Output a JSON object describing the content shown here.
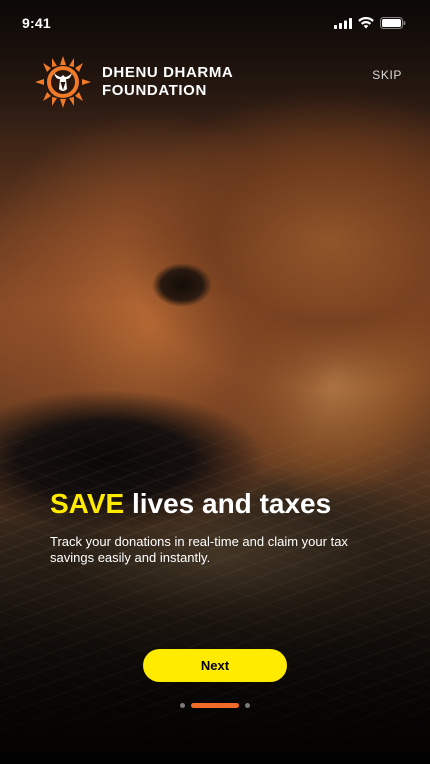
{
  "status_bar": {
    "time": "9:41",
    "icons": [
      "cellular-signal-icon",
      "wifi-icon",
      "battery-icon"
    ]
  },
  "header": {
    "brand_line1": "DHENU DHARMA",
    "brand_line2": "FOUNDATION",
    "logo_icon": "sun-cow-logo",
    "skip_label": "SKIP"
  },
  "hero": {
    "title_accent": "SAVE",
    "title_rest": " lives and taxes",
    "subtitle": "Track your donations in real-time and claim your tax savings easily and instantly."
  },
  "cta": {
    "next_label": "Next"
  },
  "pager": {
    "count": 3,
    "active_index": 1
  },
  "colors": {
    "accent_yellow": "#ffea00",
    "button_yellow": "#ffeb00",
    "pager_active": "#f06a2a",
    "logo_orange": "#f07a28"
  }
}
